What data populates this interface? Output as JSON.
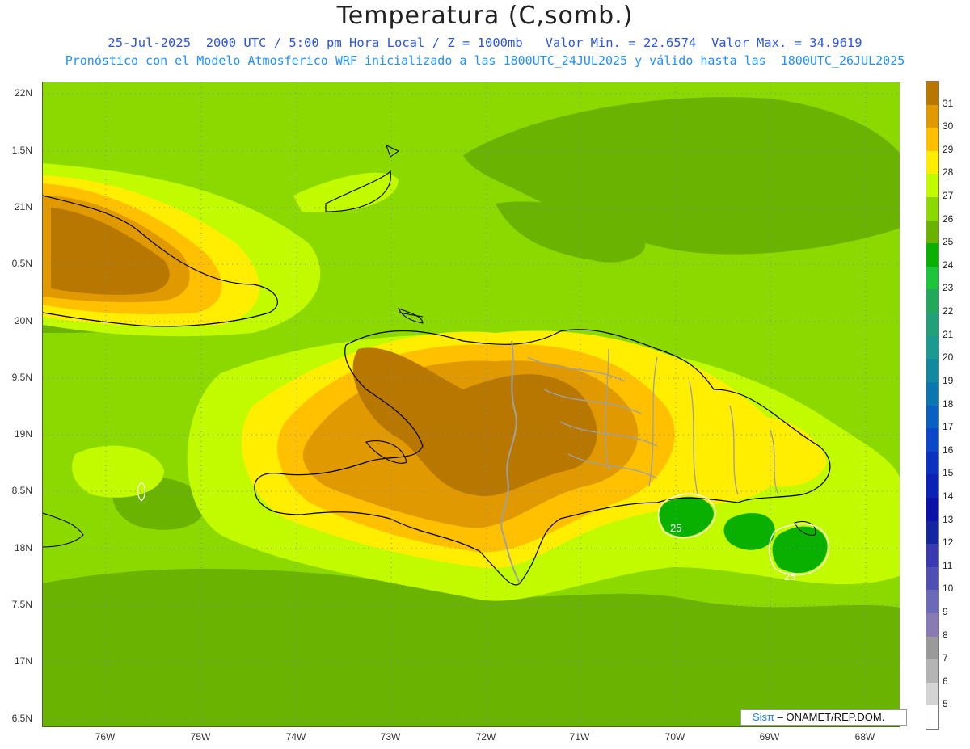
{
  "title": "Temperatura (C,somb.)",
  "subtitle_line1": "25-Jul-2025  2000 UTC / 5:00 pm Hora Local / Z = 1000mb   Valor Min. = 22.6574  Valor Max. = 34.9619",
  "subtitle_line2": "Pronóstico con el Modelo Atmosferico WRF inicializado a las 1800UTC_24JUL2025 y válido hasta las  1800UTC_26JUL2025",
  "credit_brand": "Sisπ",
  "credit_org": "– ONAMET/REP.DOM.",
  "lat_labels": [
    "22N",
    "1.5N",
    "21N",
    "0.5N",
    "20N",
    "9.5N",
    "19N",
    "8.5N",
    "18N",
    "7.5N",
    "17N",
    "6.5N"
  ],
  "lon_labels": [
    "76W",
    "75W",
    "74W",
    "73W",
    "72W",
    "71W",
    "70W",
    "69W",
    "68W"
  ],
  "contour_labels": [
    "25",
    "25"
  ],
  "colorbar": {
    "labels": [
      "31",
      "30",
      "29",
      "28",
      "27",
      "26",
      "25",
      "24",
      "23",
      "22",
      "21",
      "20",
      "19",
      "18",
      "17",
      "16",
      "15",
      "14",
      "13",
      "12",
      "11",
      "10",
      "9",
      "8",
      "7",
      "6",
      "5"
    ],
    "colors": [
      "#b87800",
      "#e09a00",
      "#ffc000",
      "#ffee00",
      "#c2fa00",
      "#8cd900",
      "#6ab300",
      "#0ab000",
      "#1ec43a",
      "#22a85c",
      "#21a07a",
      "#1a9a90",
      "#118aa0",
      "#0c76b0",
      "#0a5fc2",
      "#0a48c9",
      "#0a33c4",
      "#0a22b8",
      "#0a12a8",
      "#1426a0",
      "#3a3ab0",
      "#5050b4",
      "#6a6ab8",
      "#8a7ab4",
      "#9a9a9a",
      "#b4b4b4",
      "#d4d4d4",
      "#ffffff"
    ]
  },
  "map_colors": {
    "t27": "#c2fa00",
    "t26": "#8cd900",
    "t25": "#6ab300",
    "t24": "#0ab000",
    "t28": "#ffee00",
    "t29": "#ffc000",
    "t30": "#e09a00",
    "t31": "#b87800",
    "coast": "#000000",
    "border": "#a0a0a0",
    "grid": "#7a88c8"
  }
}
